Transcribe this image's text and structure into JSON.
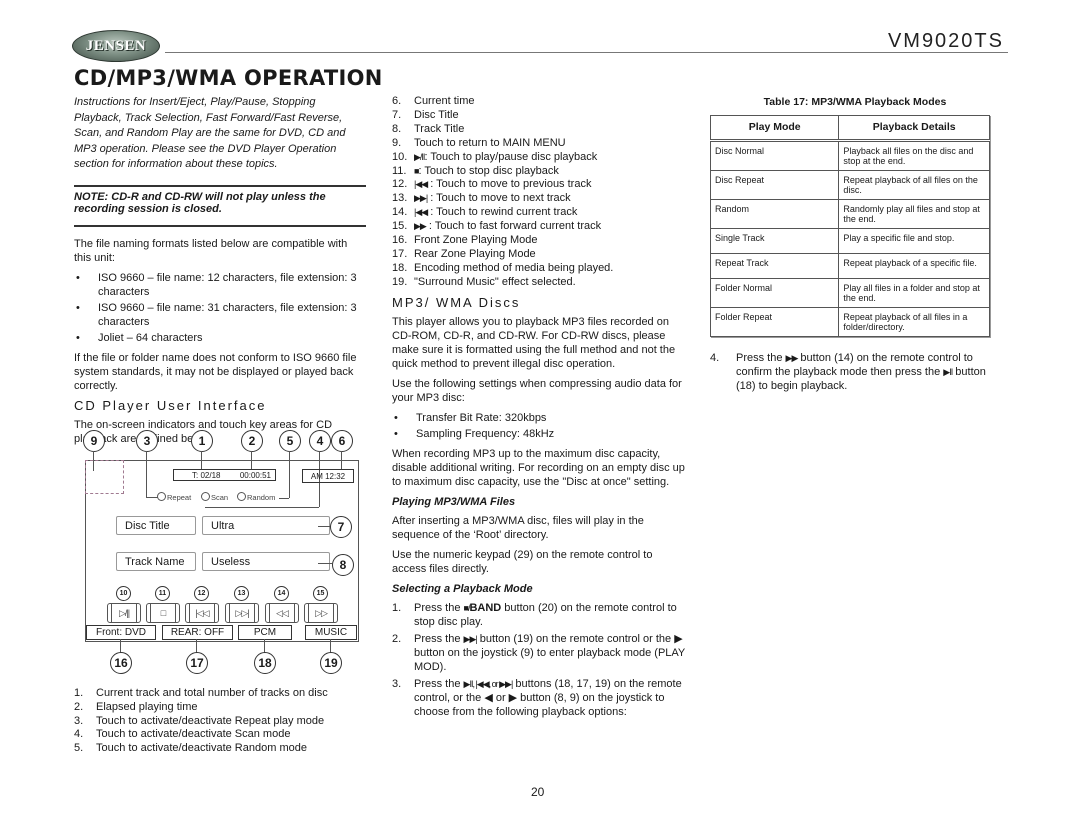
{
  "header": {
    "logo_text": "JENSEN",
    "model": "VM9020TS",
    "title": "CD/MP3/WMA OPERATION"
  },
  "left": {
    "intro": "Instructions for Insert/Eject, Play/Pause, Stopping Playback, Track Selection, Fast Forward/Fast Reverse, Scan, and Random Play are the same for DVD, CD and MP3 operation. Please see the DVD Player Operation section for information about these topics.",
    "note": "NOTE: CD-R and CD-RW will not play unless the recording session is closed.",
    "naming_intro": "The file naming formats listed below are compatible with this unit:",
    "naming_formats": [
      "ISO 9660 – file name: 12 characters, file extension: 3 characters",
      "ISO 9660 – file name: 31 characters, file extension: 3 characters",
      "Joliet – 64 characters"
    ],
    "naming_warning": "If the file or folder name does not conform to ISO 9660 file system standards, it may not be displayed or played back correctly.",
    "ui_heading": "CD Player User Interface",
    "ui_intro": "The on-screen indicators and touch key areas for CD playback are outlined below.",
    "legend_1_5": [
      {
        "n": "1.",
        "text": "Current track and total number of tracks on disc"
      },
      {
        "n": "2.",
        "text": "Elapsed playing time"
      },
      {
        "n": "3.",
        "text": "Touch to activate/deactivate Repeat play mode"
      },
      {
        "n": "4.",
        "text": "Touch to activate/deactivate Scan mode"
      },
      {
        "n": "5.",
        "text": "Touch to activate/deactivate Random mode"
      }
    ]
  },
  "diagram": {
    "callouts_top": [
      "9",
      "3",
      "1",
      "2",
      "5",
      "4",
      "6"
    ],
    "track": "T: 02/18",
    "elapsed": "00:00:51",
    "clock": "AM 12:32",
    "repeat_label": "Repeat",
    "scan_label": "Scan",
    "random_label": "Random",
    "disc_title_label": "Disc Title",
    "disc_title_value": "Ultra",
    "track_name_label": "Track Name",
    "track_name_value": "Useless",
    "callout_7": "7",
    "callout_8": "8",
    "control_callouts": [
      "10",
      "11",
      "12",
      "13",
      "14",
      "15"
    ],
    "controls": [
      {
        "name": "play-pause",
        "glyph": "▷/||"
      },
      {
        "name": "stop",
        "glyph": "□"
      },
      {
        "name": "previous",
        "glyph": "|◁◁"
      },
      {
        "name": "next",
        "glyph": "▷▷|"
      },
      {
        "name": "rewind",
        "glyph": "◁◁"
      },
      {
        "name": "fast-forward",
        "glyph": "▷▷"
      }
    ],
    "front_zone": "Front: DVD",
    "rear_zone": "REAR: OFF",
    "encoding": "PCM",
    "surround": "MUSIC",
    "callouts_bottom": [
      "16",
      "17",
      "18",
      "19"
    ]
  },
  "middle": {
    "legend_6_19": [
      {
        "n": "6.",
        "text": "Current time"
      },
      {
        "n": "7.",
        "text": "Disc Title"
      },
      {
        "n": "8.",
        "text": "Track Title"
      },
      {
        "n": "9.",
        "text": "Touch to return to MAIN MENU"
      },
      {
        "n": "10.",
        "sym": "▶/II",
        "text": ": Touch to play/pause disc playback"
      },
      {
        "n": "11.",
        "sym": "■",
        "text": ": Touch to stop disc playback"
      },
      {
        "n": "12.",
        "sym": "|◀◀",
        "text": " : Touch to move to previous track"
      },
      {
        "n": "13.",
        "sym": "▶▶|",
        "text": " : Touch to move to next track"
      },
      {
        "n": "14.",
        "sym": "|◀◀",
        "text": " : Touch to rewind current track"
      },
      {
        "n": "15.",
        "sym": "▶▶",
        "text": " : Touch to fast forward current track"
      },
      {
        "n": "16.",
        "text": "Front Zone Playing Mode"
      },
      {
        "n": "17.",
        "text": "Rear Zone Playing Mode"
      },
      {
        "n": "18.",
        "text": "Encoding method of media being played."
      },
      {
        "n": "19.",
        "text": "\"Surround Music\" effect selected."
      }
    ],
    "mp3_heading": "MP3/ WMA Discs",
    "mp3_intro": "This player allows you to playback MP3 files recorded on CD-ROM, CD-R, and CD-RW. For CD-RW discs, please make sure it is formatted using the full method and not the quick method to prevent illegal disc operation.",
    "compress_intro": "Use the following settings when compressing audio data for your MP3 disc:",
    "compress_settings": [
      "Transfer Bit Rate: 320kbps",
      "Sampling Frequency: 48kHz"
    ],
    "capacity_text": "When recording MP3 up to the maximum disc capacity, disable additional writing. For recording on an empty disc up to maximum disc capacity, use the \"Disc at once\" setting.",
    "playing_heading": "Playing MP3/WMA Files",
    "playing_text": "After inserting a MP3/WMA disc, files will play in the sequence of the ‘Root’ directory.",
    "keypad_text": "Use the numeric keypad (29) on the remote control to access files directly.",
    "select_heading": "Selecting a Playback Mode",
    "steps": [
      {
        "n": "1.",
        "pre": "Press the ",
        "sym": "■/",
        "bold": "BAND",
        "text": " button (20) on the remote control to stop disc play."
      },
      {
        "n": "2.",
        "pre": "Press the ",
        "sym": "▶▶|",
        "bold": "",
        "text": " button (19) on the remote control or the ▶ button on the joystick (9) to enter playback mode (PLAY MOD)."
      },
      {
        "n": "3.",
        "pre": "Press the ",
        "sym": "▶II, |◀◀, or ▶▶|",
        "bold": "",
        "text": " buttons (18, 17, 19) on the remote control, or the ◀ or ▶ button (8, 9) on the joystick to choose from the following playback options:"
      }
    ]
  },
  "right": {
    "table_caption": "Table 17: MP3/WMA Playback Modes",
    "table_headers": [
      "Play Mode",
      "Playback Details"
    ],
    "table_rows": [
      [
        "Disc Normal",
        "Playback all files on the disc and stop at the end."
      ],
      [
        "Disc Repeat",
        "Repeat playback of all files on the disc."
      ],
      [
        "Random",
        "Randomly play all files and stop at the end."
      ],
      [
        "Single Track",
        "Play a specific file and stop."
      ],
      [
        "Repeat Track",
        "Repeat playback of a specific file."
      ],
      [
        "Folder Normal",
        "Play all files in a folder and stop at the end."
      ],
      [
        "Folder Repeat",
        "Repeat playback of all files in a folder/directory."
      ]
    ],
    "step4": {
      "n": "4.",
      "pre": "Press the ",
      "sym1": "▶▶",
      "mid": " button (14) on the remote control to confirm the playback mode then press the ",
      "sym2": "▶II",
      "post": " button (18) to begin playback."
    }
  },
  "footer": {
    "page_number": "20"
  }
}
